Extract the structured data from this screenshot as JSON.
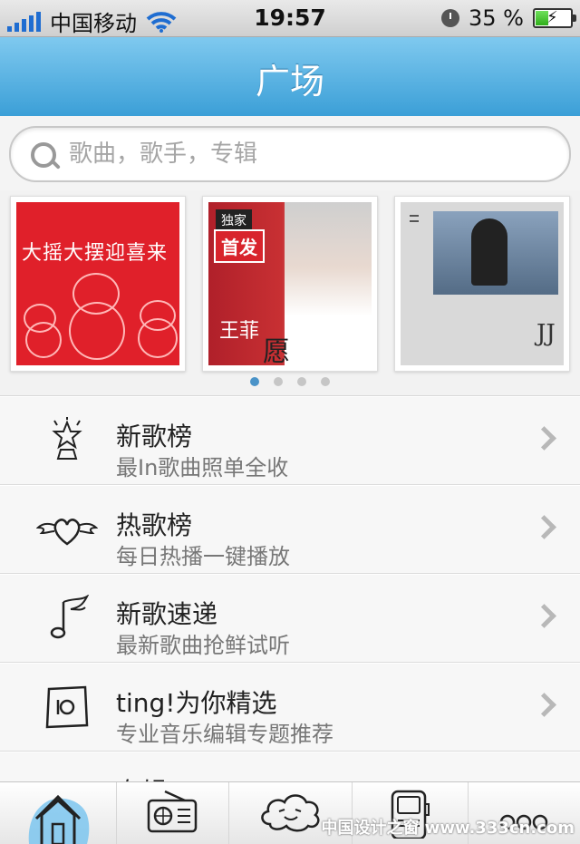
{
  "status_bar": {
    "carrier": "中国移动",
    "time": "19:57",
    "battery": "35 %",
    "battery_level": 0.35
  },
  "header": {
    "title": "广场"
  },
  "search": {
    "placeholder": "歌曲，歌手，专辑"
  },
  "albums": [
    {
      "icon": "album-cover",
      "cover_text": "大摇大摆迎喜来"
    },
    {
      "icon": "album-cover",
      "badge": "独家",
      "badge2": "首发",
      "artist": "王菲",
      "title": "愿"
    },
    {
      "icon": "album-cover",
      "signature": "JJ"
    }
  ],
  "carousel": {
    "page_count": 4,
    "active_page": 1
  },
  "list": [
    {
      "title": "新歌榜",
      "subtitle": "最In歌曲照单全收",
      "icon": "trophy-star-icon"
    },
    {
      "title": "热歌榜",
      "subtitle": "每日热播一键播放",
      "icon": "winged-heart-icon"
    },
    {
      "title": "新歌速递",
      "subtitle": "最新歌曲抢鲜试听",
      "icon": "music-note-icon"
    },
    {
      "title": "ting!为你精选",
      "subtitle": "专业音乐编辑专题推荐",
      "icon": "speaker-icon"
    },
    {
      "title": "专辑",
      "subtitle": "",
      "icon": "album-icon"
    }
  ],
  "tabs": [
    {
      "icon": "home-icon",
      "selected": true
    },
    {
      "icon": "radio-icon",
      "selected": false
    },
    {
      "icon": "cloud-icon",
      "selected": false
    },
    {
      "icon": "music-player-icon",
      "selected": false
    },
    {
      "icon": "more-icon",
      "selected": false
    }
  ],
  "watermark": "中国设计之窗 www.333cn.com",
  "colors": {
    "title_bar": "#4aaee2",
    "active_dot": "#4a93c8",
    "signal": "#1f6dd1"
  }
}
